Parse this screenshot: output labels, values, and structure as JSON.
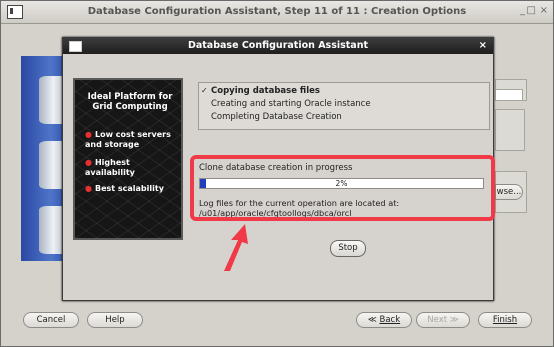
{
  "outer_window": {
    "title": "Database Configuration Assistant, Step 11 of 11 : Creation Options",
    "controls": {
      "minimize": "_",
      "maximize": "□",
      "close": "×"
    },
    "browse_partial": "wse...",
    "buttons": {
      "cancel": "Cancel",
      "help": "Help",
      "back": "Back",
      "next": "Next",
      "finish": "Finish"
    }
  },
  "dialog": {
    "title": "Database Configuration Assistant",
    "close": "×",
    "side_panel": {
      "heading": "Ideal Platform for Grid Computing",
      "bullets": [
        "Low cost servers and storage",
        "Highest availability",
        "Best scalability"
      ]
    },
    "steps": [
      {
        "label": "Copying database files",
        "done": true,
        "mark": "✓"
      },
      {
        "label": "Creating and starting Oracle instance",
        "done": false
      },
      {
        "label": "Completing Database Creation",
        "done": false
      }
    ],
    "progress": {
      "label": "Clone database creation in progress",
      "percent": 2,
      "percent_text": "2%"
    },
    "log": {
      "line1": "Log files for the current operation are located at:",
      "line2": "/u01/app/oracle/cfgtoollogs/dbca/orcl"
    },
    "stop_label": "Stop"
  },
  "colors": {
    "highlight": "#f03a48",
    "progress_fill": "#1f3fbf",
    "dialog_title_bg": "#2a2a2a"
  }
}
